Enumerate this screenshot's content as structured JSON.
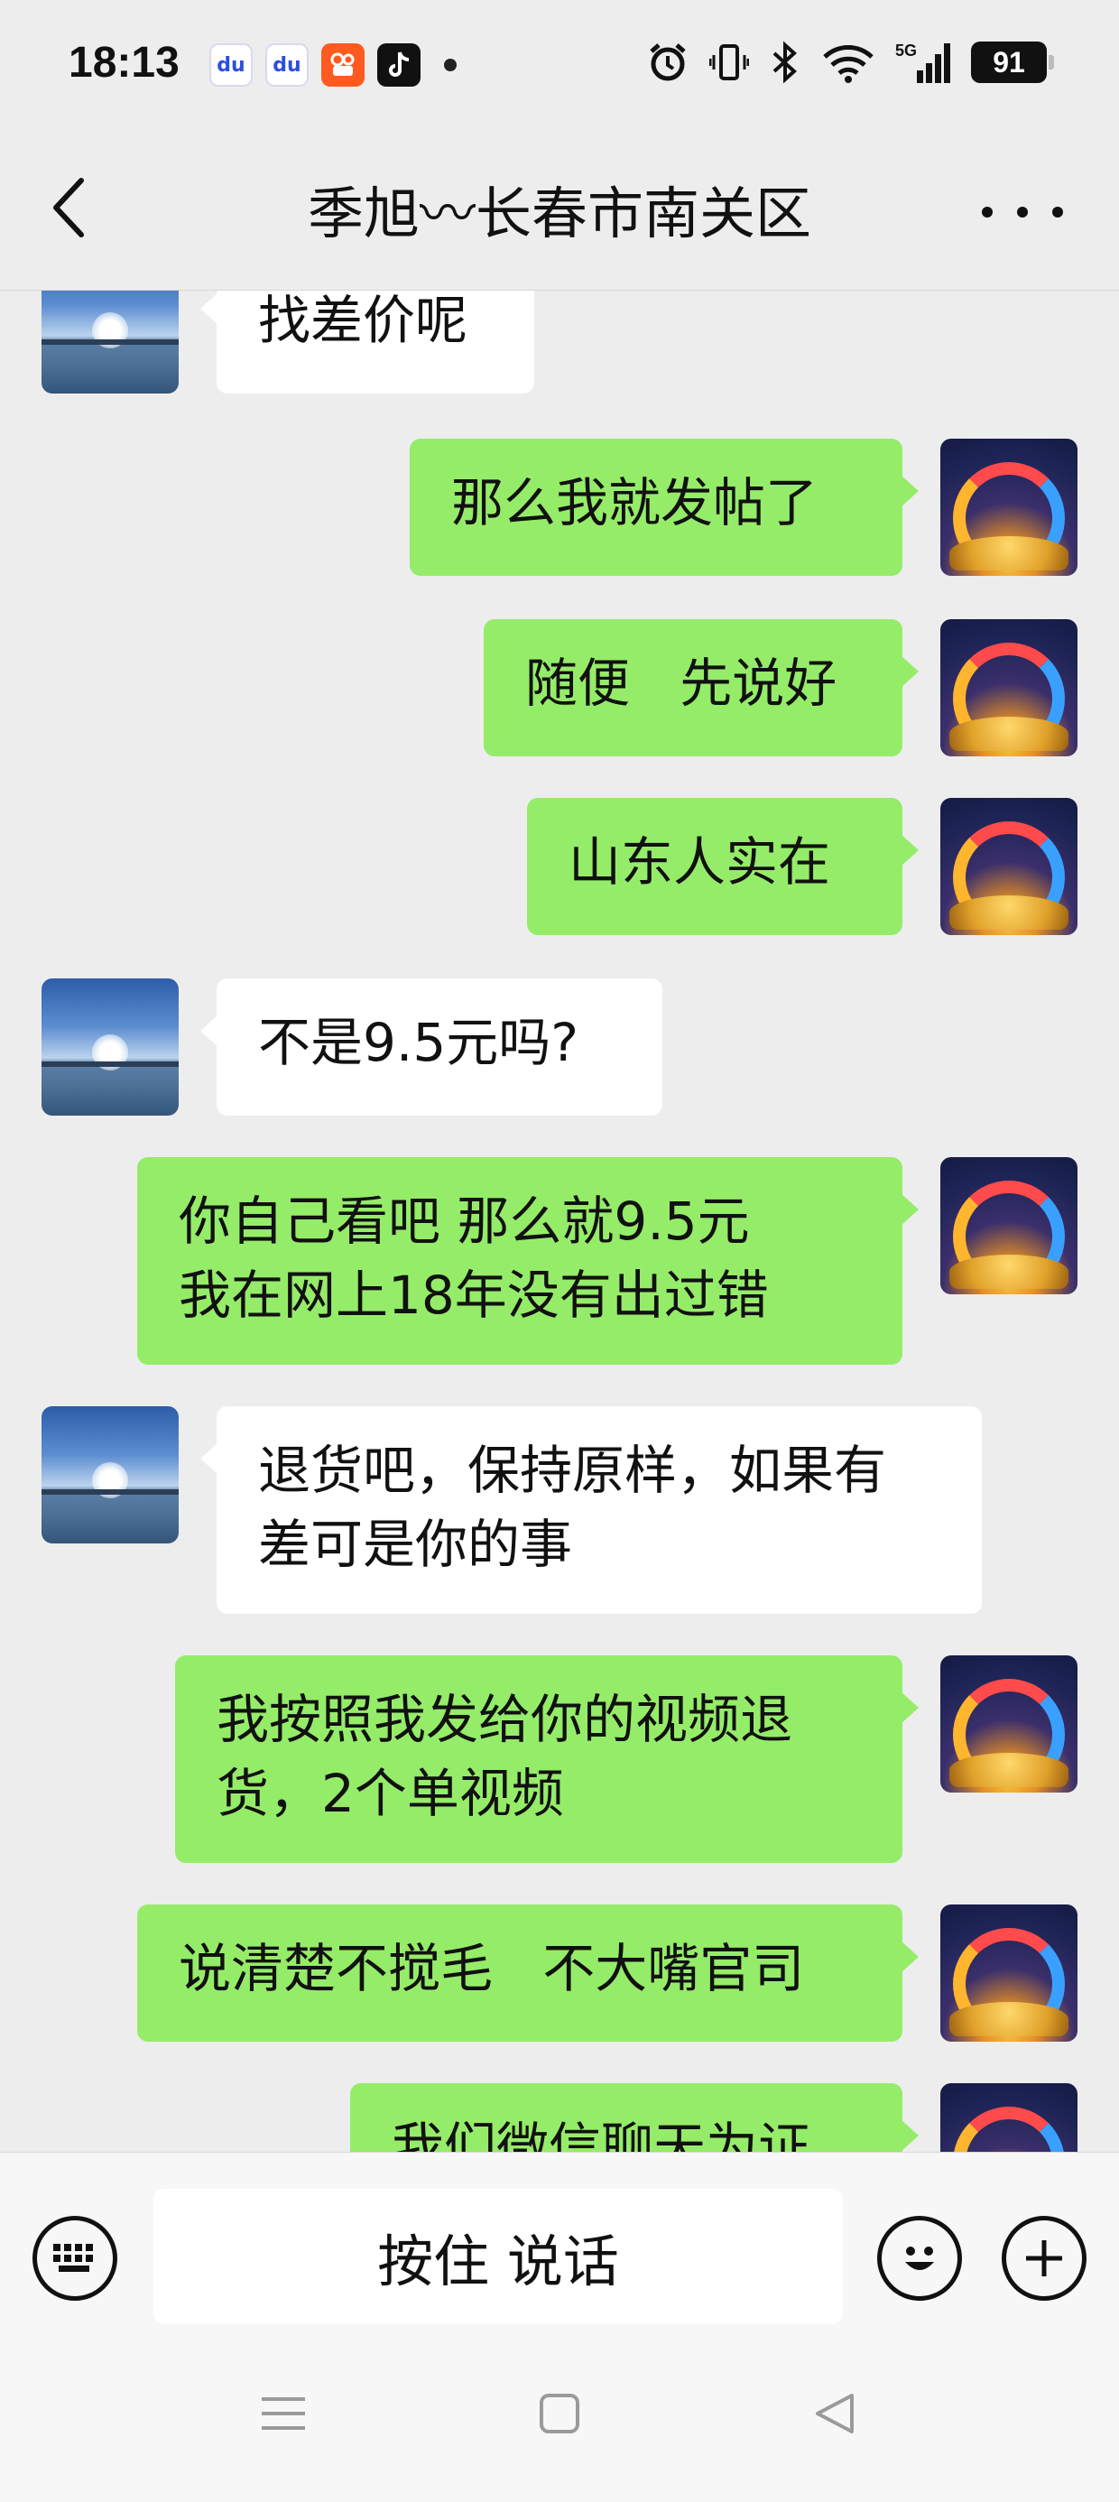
{
  "status_bar": {
    "time": "18:13",
    "apps": [
      "baidu-lite-icon",
      "baidu-icon",
      "kuaishou-icon",
      "tiktok-icon"
    ],
    "battery": "91",
    "network": "5G"
  },
  "header": {
    "title": "季旭〰长春市南关区",
    "back_icon": "chevron-left-icon",
    "more_icon": "more-dots-icon"
  },
  "messages": [
    {
      "side": "left",
      "text": "找差价呢"
    },
    {
      "side": "right",
      "text": "那么我就发帖了"
    },
    {
      "side": "right",
      "text": "随便   先说好"
    },
    {
      "side": "right",
      "text": "山东人实在"
    },
    {
      "side": "left",
      "text": "不是9.5元吗?"
    },
    {
      "side": "right",
      "text": "你自己看吧 那么就9.5元\n我在网上18年没有出过错"
    },
    {
      "side": "left",
      "text": "退货吧，保持原样，如果有\n差可是你的事"
    },
    {
      "side": "right",
      "text": "我按照我发给你的视频退\n货，2个单视频"
    },
    {
      "side": "right",
      "text": "说清楚不搅毛   不大嘴官司"
    },
    {
      "side": "right",
      "text": "我们微信聊天为证"
    }
  ],
  "input_bar": {
    "hold_to_talk": "按住 说话",
    "keyboard_icon": "keyboard-icon",
    "emoji_icon": "emoji-icon",
    "plus_icon": "plus-icon"
  },
  "colors": {
    "background": "#ededed",
    "bubble_self": "#95ec69",
    "bubble_other": "#ffffff"
  }
}
